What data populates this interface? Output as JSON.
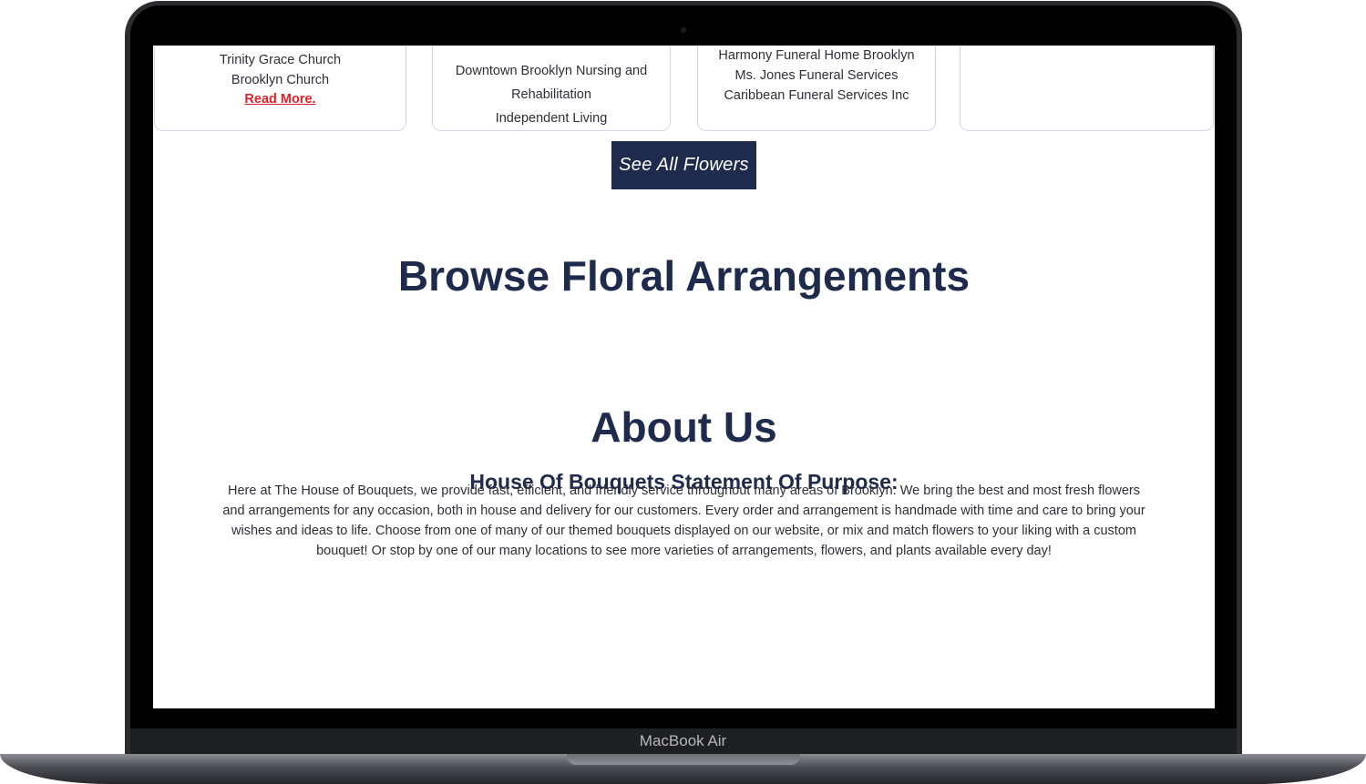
{
  "device": {
    "label": "MacBook Air"
  },
  "cards": [
    {
      "lines": [
        "Trinity Grace Church",
        "Brooklyn Church"
      ],
      "link": "Read More."
    },
    {
      "lines": [
        "Downtown Brooklyn Nursing and",
        "Rehabilitation",
        "Independent Living"
      ]
    },
    {
      "lines": [
        "Harmony Funeral Home Brooklyn",
        "Ms. Jones Funeral Services",
        "Caribbean Funeral Services Inc"
      ]
    },
    {
      "lines": []
    }
  ],
  "see_all_button": "See All Flowers",
  "browse": {
    "heading": "Browse Floral Arrangements"
  },
  "about": {
    "heading": "About Us",
    "subheading": "House Of Bouquets Statement Of Purpose:",
    "body": "Here at The House of Bouquets, we provide fast, efficient, and friendly service throughout many areas of Brooklyn. We bring the best and most fresh flowers and arrangements for any occasion, both in house and delivery for our customers. Every order and arrangement is handmade with time and care to bring your wishes and ideas to life. Choose from one of many of our themed bouquets displayed on our website, or mix and match flowers to your liking with a custom bouquet! Or stop by one of our many locations to see more varieties of arrangements, flowers, and plants available every day!"
  }
}
